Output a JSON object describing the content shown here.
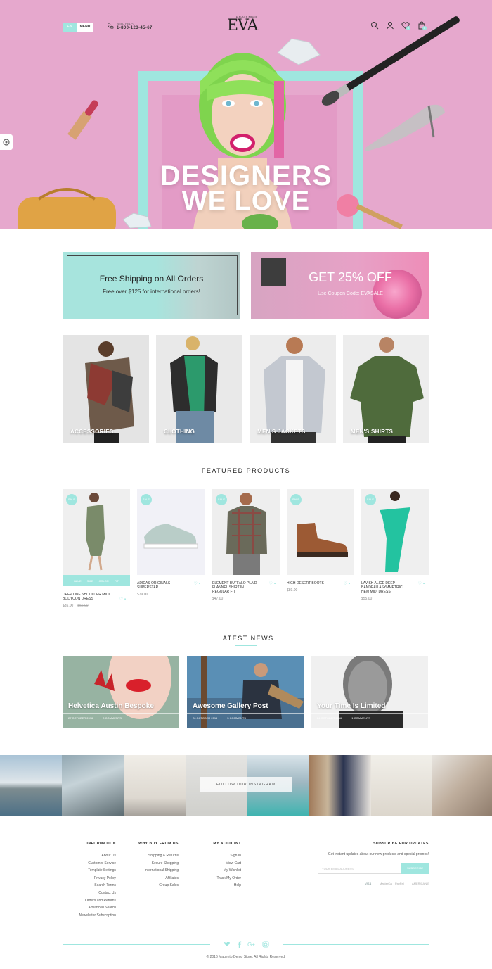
{
  "header": {
    "lang_button": "EN",
    "menu_button": "MENU",
    "help_label": "NEED HELP?",
    "phone": "1-800-123-45-67",
    "logo_tagline": "E-BLACK BRAND",
    "logo": "EVA",
    "wishlist_count": "0",
    "cart_count": "0"
  },
  "hero": {
    "line1": "DESIGNERS",
    "line2": "WE LOVE"
  },
  "promos": {
    "shipping_title": "Free Shipping on All Orders",
    "shipping_sub": "Free over $125 for international orders!",
    "discount_title": "GET 25% OFF",
    "discount_sub": "Use Coupon Code: EVASALE"
  },
  "categories": [
    {
      "label": "ACCESSORIES"
    },
    {
      "label": "CLOTHING"
    },
    {
      "label": "MEN'S JACKETS"
    },
    {
      "label": "MEN'S SHIRTS"
    }
  ],
  "featured": {
    "title": "FEATURED PRODUCTS",
    "sale_label": "SALE",
    "sizes": [
      "BLUE",
      "SIZE",
      "COLOR",
      "FIT"
    ],
    "products": [
      {
        "name": "DEEP ONE SHOULDER MIDI BODYCON DRESS",
        "price": "$35.00",
        "old_price": "$56.00"
      },
      {
        "name": "ADIDAS ORIGINALS SUPERSTAR",
        "price": "$79.00",
        "old_price": ""
      },
      {
        "name": "ELEMENT BUFFALO PLAID FLANNEL SHIRT IN REGULAR FIT",
        "price": "$47.00",
        "old_price": ""
      },
      {
        "name": "HIGH DESERT BOOTS",
        "price": "$89.00",
        "old_price": ""
      },
      {
        "name": "LAVISH ALICE DEEP BANDEAU ASYMMETRIC HEM MIDI DRESS",
        "price": "$55.00",
        "old_price": ""
      }
    ]
  },
  "news": {
    "title": "LATEST NEWS",
    "items": [
      {
        "title": "Helvetica Austin Bespoke",
        "date": "27 OCTOBER 2016",
        "comments": "0 COMMENTS"
      },
      {
        "title": "Awesome Gallery Post",
        "date": "26 OCTOBER 2016",
        "comments": "3 COMMENTS"
      },
      {
        "title": "Your Time Is Limited",
        "date": "24 OCTOBER 2016",
        "comments": "1 COMMENTS"
      }
    ]
  },
  "instagram": {
    "follow": "FOLLOW OUR INSTAGRAM"
  },
  "footer": {
    "information": {
      "heading": "INFORMATION",
      "links": [
        "About Us",
        "Customer Service",
        "Template Settings",
        "Privacy Policy",
        "Search Terms",
        "Contact Us",
        "Orders and Returns",
        "Advanced Search",
        "Newsletter Subscription"
      ]
    },
    "why_buy": {
      "heading": "WHY BUY FROM US",
      "links": [
        "Shipping & Returns",
        "Secure Shopping",
        "International Shipping",
        "Affiliates",
        "Group Sales"
      ]
    },
    "account": {
      "heading": "MY ACCOUNT",
      "links": [
        "Sign In",
        "View Cart",
        "My Wishlist",
        "Track My Order",
        "Help"
      ]
    },
    "subscribe": {
      "heading": "SUBSCRIBE FOR UPDATES",
      "text": "Get instant updates about our new products and special promos!",
      "placeholder": "YOUR EMAIL ADDRESS",
      "button": "SUBSCRIBE"
    },
    "payments": [
      "VISA",
      "MasterCard",
      "PayPal",
      "AMERICAN EXPRESS"
    ],
    "copyright": "© 2016 Magento Demo Store. All Rights Reserved."
  },
  "colors": {
    "accent": "#9fe6df",
    "hero_pink": "#e6a8cd"
  }
}
